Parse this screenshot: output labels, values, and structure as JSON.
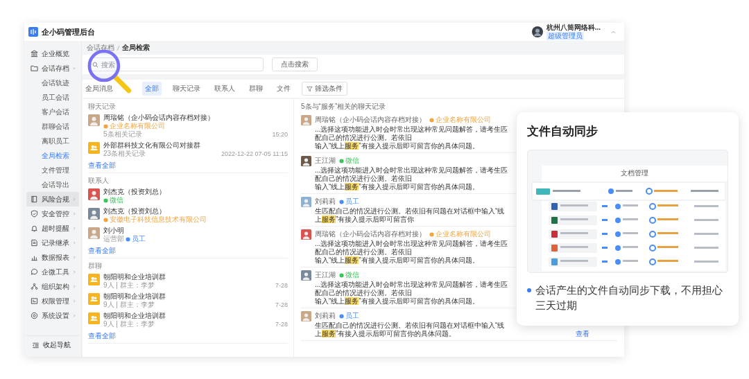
{
  "header": {
    "title": "企小码管理后台",
    "user": {
      "name": "杭州八筒网络科...",
      "role": "超级管理员"
    }
  },
  "sidebar": {
    "items": [
      {
        "label": "企业概览",
        "selected": false,
        "highlighted": false
      },
      {
        "label": "会话存档",
        "selected": false,
        "highlighted": false,
        "expanded": true,
        "children": [
          {
            "label": "会话轨迹",
            "selected": false
          },
          {
            "label": "员工会话",
            "selected": false
          },
          {
            "label": "客户会话",
            "selected": false
          },
          {
            "label": "群聊会话",
            "selected": false
          },
          {
            "label": "离职员工",
            "selected": false
          },
          {
            "label": "全局检索",
            "selected": true
          },
          {
            "label": "文件管理",
            "selected": false
          },
          {
            "label": "会话导出",
            "selected": false
          }
        ]
      },
      {
        "label": "风险合规",
        "selected": false,
        "highlighted": true,
        "expanded": false
      },
      {
        "label": "安全管控",
        "selected": false,
        "highlighted": false,
        "expanded": false
      },
      {
        "label": "超时提醒",
        "selected": false,
        "highlighted": false,
        "expanded": false
      },
      {
        "label": "记录继承",
        "selected": false,
        "highlighted": false,
        "expanded": false
      },
      {
        "label": "数据报表",
        "selected": false,
        "highlighted": false,
        "expanded": false
      },
      {
        "label": "企微工具",
        "selected": false,
        "highlighted": false,
        "expanded": false
      },
      {
        "label": "组织架构",
        "selected": false,
        "highlighted": false,
        "expanded": false
      },
      {
        "label": "权限管理",
        "selected": false,
        "highlighted": false,
        "expanded": false
      },
      {
        "label": "系统设置",
        "selected": false,
        "highlighted": false,
        "expanded": false
      }
    ],
    "collapse_label": "收起导航"
  },
  "breadcrumb": [
    "会话存档",
    "全局检索"
  ],
  "search": {
    "placeholder": "搜索",
    "button": "点击搜索"
  },
  "tabs": [
    {
      "label": "全局消息",
      "selected": false
    },
    {
      "label": "全部",
      "selected": true
    },
    {
      "label": "聊天记录",
      "selected": false
    },
    {
      "label": "联系人",
      "selected": false
    },
    {
      "label": "群聊",
      "selected": false
    },
    {
      "label": "文件",
      "selected": false
    }
  ],
  "filter_button": "筛选条件",
  "sections": [
    {
      "title": "聊天记录",
      "more": "查看全部",
      "items": [
        {
          "kind": "person",
          "name": "周瑞铭（企小码会话内容存档对接）",
          "tag": {
            "text": "企业名称有限公司",
            "color": "#f0a444"
          },
          "subtitle": "5条相关记录",
          "time": "15:20"
        },
        {
          "kind": "group",
          "name": "外部群科技文化有限公司对接群",
          "subtitle": "23条相关记录",
          "time": "2022-12-22 07-05 11:15"
        }
      ]
    },
    {
      "title": "联系人",
      "more": "查看全部",
      "items": [
        {
          "kind": "person",
          "name": "刘杰克（投资刘总）",
          "tag": {
            "text": "微信",
            "color": "#3cc35a"
          }
        },
        {
          "kind": "person",
          "name": "刘杰克（投资刘总）",
          "tag": {
            "text": "安徽电子科技信息技术有限公司",
            "color": "#f0a444"
          }
        },
        {
          "kind": "person",
          "name": "刘小明",
          "tag": {
            "prefix": "运营部",
            "text": "员工",
            "color": "#4b8df8"
          }
        }
      ]
    },
    {
      "title": "群聊",
      "more": "查看全部",
      "items": [
        {
          "kind": "group",
          "name": "朝阳明和企业培训群",
          "subtitle": "9人 | 群主：李梦",
          "time": "7-28"
        },
        {
          "kind": "group",
          "name": "朝阳明和企业培训群",
          "subtitle": "9人 | 群主：李梦",
          "time": "7-28"
        },
        {
          "kind": "group",
          "name": "朝阳明和企业培训群",
          "subtitle": "9人 | 群主：李梦",
          "time": "7-28"
        }
      ]
    }
  ],
  "messages": {
    "summary": "5条与“服务”相关的聊天记录",
    "items": [
      {
        "name": "周瑞铭（企小码会话内容存档对接）",
        "tag": {
          "text": "企业名称有限公司",
          "color": "#f0a444"
        },
        "lines": [
          [
            {
              "text": "...选择这项功能进入时会时常出现这种常见问题解答，请考生匹配自己的情况进行公测。若依旧",
              "highlight": false
            }
          ],
          [
            {
              "text": "输入“线上",
              "highlight": false
            },
            {
              "text": "服务",
              "highlight": true
            },
            {
              "text": "”有接入提示后即可留言你的具体问题。",
              "highlight": false
            }
          ]
        ]
      },
      {
        "name": "王江湖",
        "tag": {
          "text": "微信",
          "color": "#3cc35a"
        },
        "lines": [
          [
            {
              "text": "...选择这项功能进入时会时常出现这种常见问题解答，请考生匹配自己的情况进行公测。若依旧",
              "highlight": false
            }
          ],
          [
            {
              "text": "输入“线上",
              "highlight": false
            },
            {
              "text": "服务",
              "highlight": true
            },
            {
              "text": "”有接入提示后即可留言你的具体问题。",
              "highlight": false
            }
          ]
        ]
      },
      {
        "name": "刘莉莉",
        "tag": {
          "text": "员工",
          "color": "#4b8df8"
        },
        "lines": [
          [
            {
              "text": "生匹配自己的情况进行公测。若依旧有问题在对话框中输入“线上",
              "highlight": false
            },
            {
              "text": "服务",
              "highlight": true
            },
            {
              "text": "”有接入提示后即可留言你",
              "highlight": false
            }
          ]
        ]
      },
      {
        "name": "周瑞铭（企小码会话内容存档对接）",
        "tag": {
          "text": "企业名称有限公司",
          "color": "#f0a444"
        },
        "lines": [
          [
            {
              "text": "...选择这项功能进入时会时常出现这种常见问题解答，请考生匹配自己的情况进行公测。若依旧",
              "highlight": false
            }
          ],
          [
            {
              "text": "输入“线上",
              "highlight": false
            },
            {
              "text": "服务",
              "highlight": true
            },
            {
              "text": "”有接入提示后即可留言你的具体问题。",
              "highlight": false
            }
          ]
        ]
      },
      {
        "name": "王江湖",
        "tag": {
          "text": "微信",
          "color": "#3cc35a"
        },
        "lines": [
          [
            {
              "text": "...选择这项功能进入时会时常出现这种常见问题解答，请考生匹配自己的情况进行公测。若依旧",
              "highlight": false
            }
          ],
          [
            {
              "text": "输入“线上",
              "highlight": false
            },
            {
              "text": "服务",
              "highlight": true
            },
            {
              "text": "”有接入提示后即可留言你的具体问题。",
              "highlight": false
            }
          ]
        ]
      },
      {
        "name": "刘莉莉",
        "tag": {
          "text": "员工",
          "color": "#4b8df8"
        },
        "lines": [
          [
            {
              "text": "生匹配自己的情况进行公测。若依旧有问题在对话框中输入“线上",
              "highlight": false
            },
            {
              "text": "服务",
              "highlight": true
            },
            {
              "text": "”有接入提示后即可留言你的具体问题。",
              "highlight": false
            }
          ]
        ],
        "link": "查看"
      }
    ]
  },
  "feature_card": {
    "title": "文件自动同步",
    "preview_title": "文档管理",
    "bullet": "会话产生的文件自动同步下载，不用担心三天过期"
  }
}
